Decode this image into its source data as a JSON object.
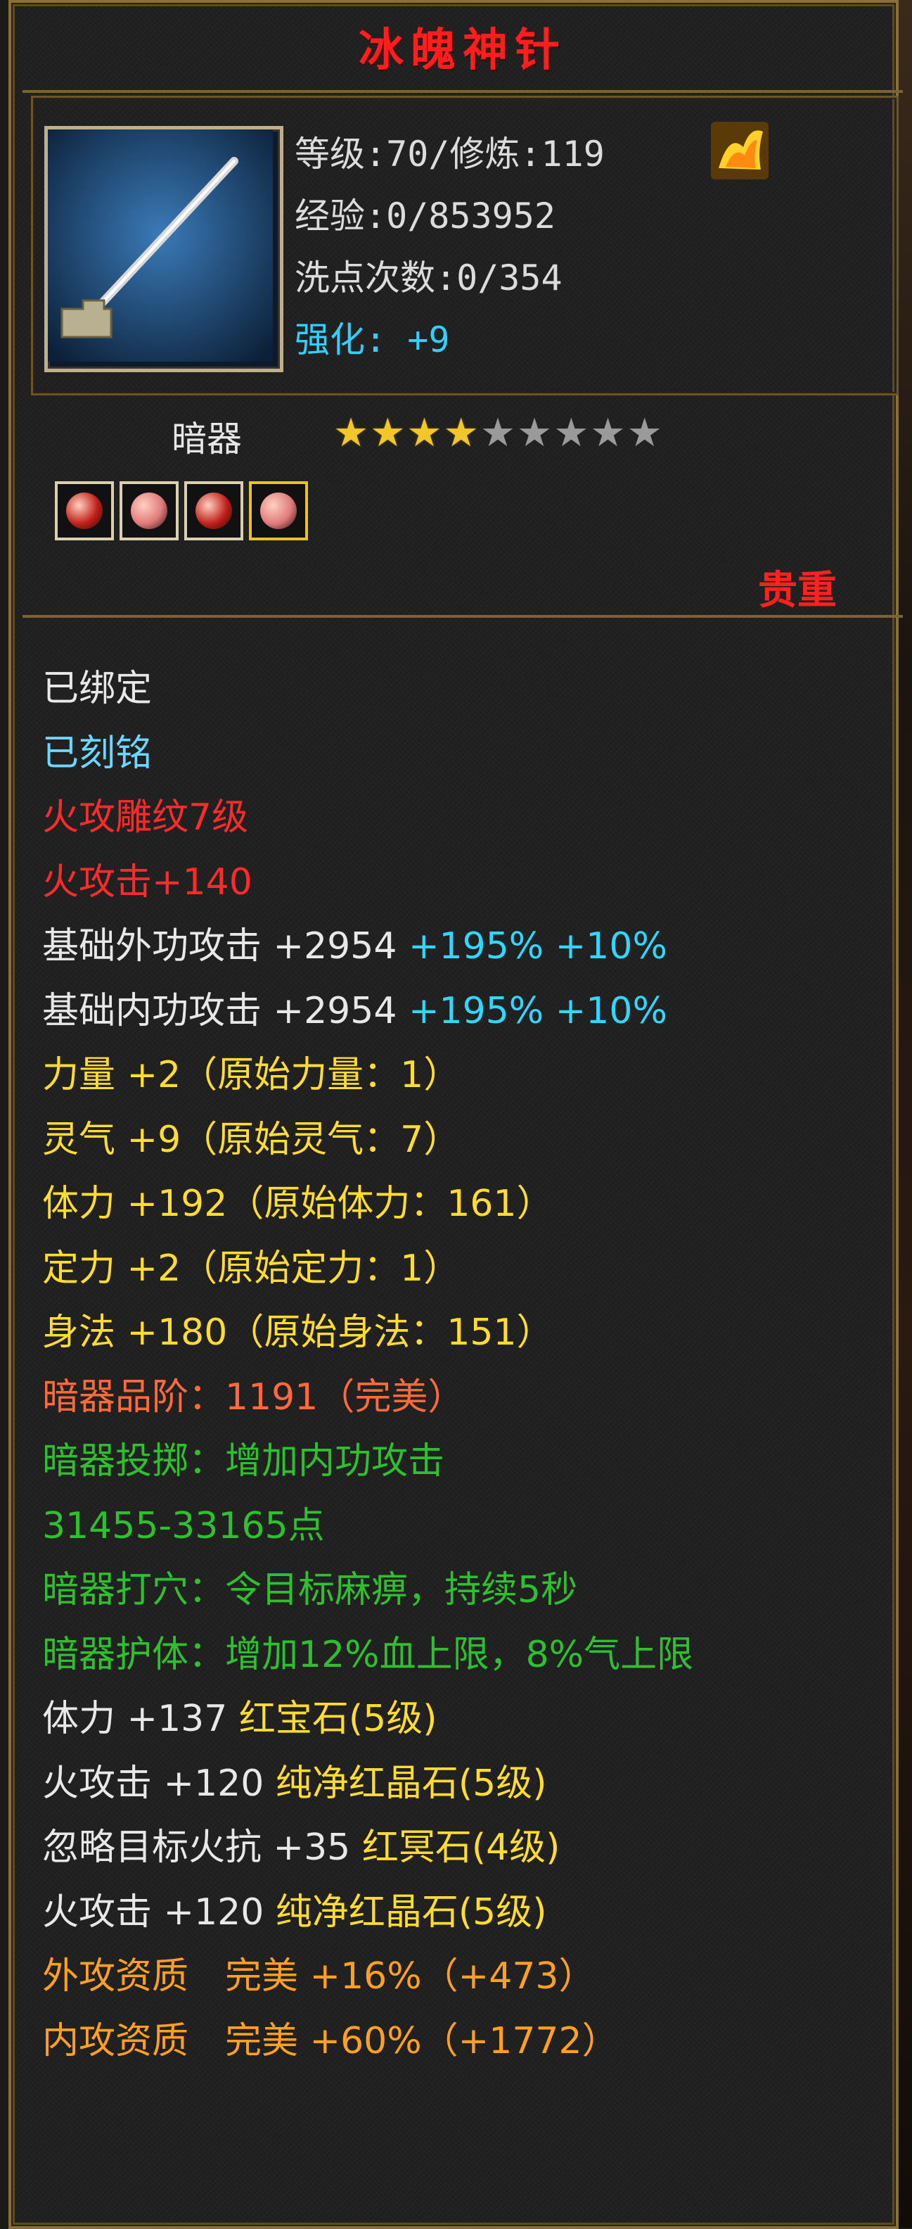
{
  "item": {
    "title": "冰魄神针",
    "level_line": "等级:70/修炼:119",
    "exp_line": "经验:0/853952",
    "reset_line": "洗点次数:0/354",
    "enhance_label": "强化:",
    "enhance_value": "+9",
    "type": "暗器",
    "stars_total": 9,
    "stars_filled": 4,
    "rarity": "贵重"
  },
  "gems": [
    {
      "name": "red-gem",
      "color": "#c0201a"
    },
    {
      "name": "pink-gem",
      "color": "#e07a7a"
    },
    {
      "name": "red-gem",
      "color": "#c0201a"
    },
    {
      "name": "pink-gem",
      "color": "#e07a7a"
    }
  ],
  "props": {
    "bound": "已绑定",
    "engraved": "已刻铭",
    "fire_pattern": "火攻雕纹7级",
    "fire_attack": "火攻击+140",
    "ext_atk_label": "基础外功攻击 +2954",
    "ext_atk_pct1": "+195%",
    "ext_atk_pct2": "+10%",
    "int_atk_label": "基础内功攻击 +2954",
    "int_atk_pct1": "+195%",
    "int_atk_pct2": "+10%",
    "str": "力量 +2（原始力量：1）",
    "spi": "灵气 +9（原始灵气：7）",
    "vit": "体力 +192（原始体力：161）",
    "foc": "定力 +2（原始定力：1）",
    "agi": "身法 +180（原始身法：151）",
    "grade": "暗器品阶：1191（完美）",
    "throw": "暗器投掷：增加内功攻击",
    "throw_value": "31455-33165点",
    "acupoint": "暗器打穴：令目标麻痹，持续5秒",
    "guard": "暗器护体：增加12%血上限，8%气上限",
    "gem1_stat": "体力 +137",
    "gem1_name": "红宝石(5级)",
    "gem2_stat": "火攻击 +120",
    "gem2_name": "纯净红晶石(5级)",
    "gem3_stat": "忽略目标火抗 +35",
    "gem3_name": "红冥石(4级)",
    "gem4_stat": "火攻击 +120",
    "gem4_name": "纯净红晶石(5级)",
    "ext_quality": "外攻资质　完美 +16%（+473）",
    "int_quality": "内攻资质　完美 +60%（+1772）"
  }
}
